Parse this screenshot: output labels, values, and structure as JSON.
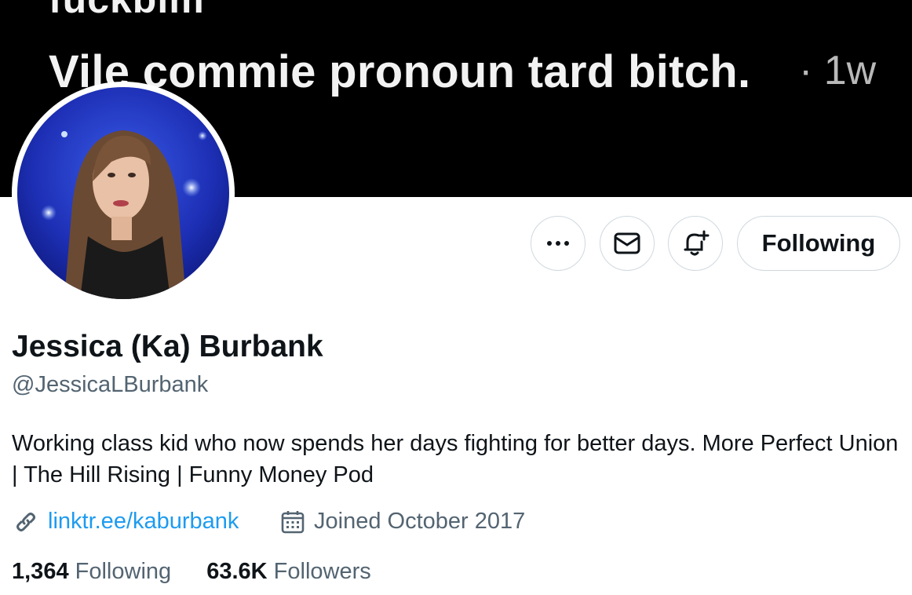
{
  "banner": {
    "line1": "fuckbim",
    "line2": "Vile commie pronoun tard bitch.",
    "time": "· 1w"
  },
  "actions": {
    "following_label": "Following"
  },
  "profile": {
    "name": "Jessica (Ka) Burbank",
    "handle": "@JessicaLBurbank",
    "bio": "Working class kid who now spends her days fighting for better days. More Perfect Union | The Hill Rising | Funny Money Pod",
    "link": "linktr.ee/kaburbank",
    "joined": "Joined October 2017"
  },
  "stats": {
    "following_count": "1,364",
    "following_label": "Following",
    "followers_count": "63.6K",
    "followers_label": "Followers"
  },
  "colors": {
    "accent": "#1d9bf0",
    "secondary_text": "#536471",
    "border": "#cfd9de",
    "banner_bg": "#000000"
  },
  "icons": [
    "more-icon",
    "mail-icon",
    "bell-plus-icon",
    "link-icon",
    "calendar-icon"
  ]
}
